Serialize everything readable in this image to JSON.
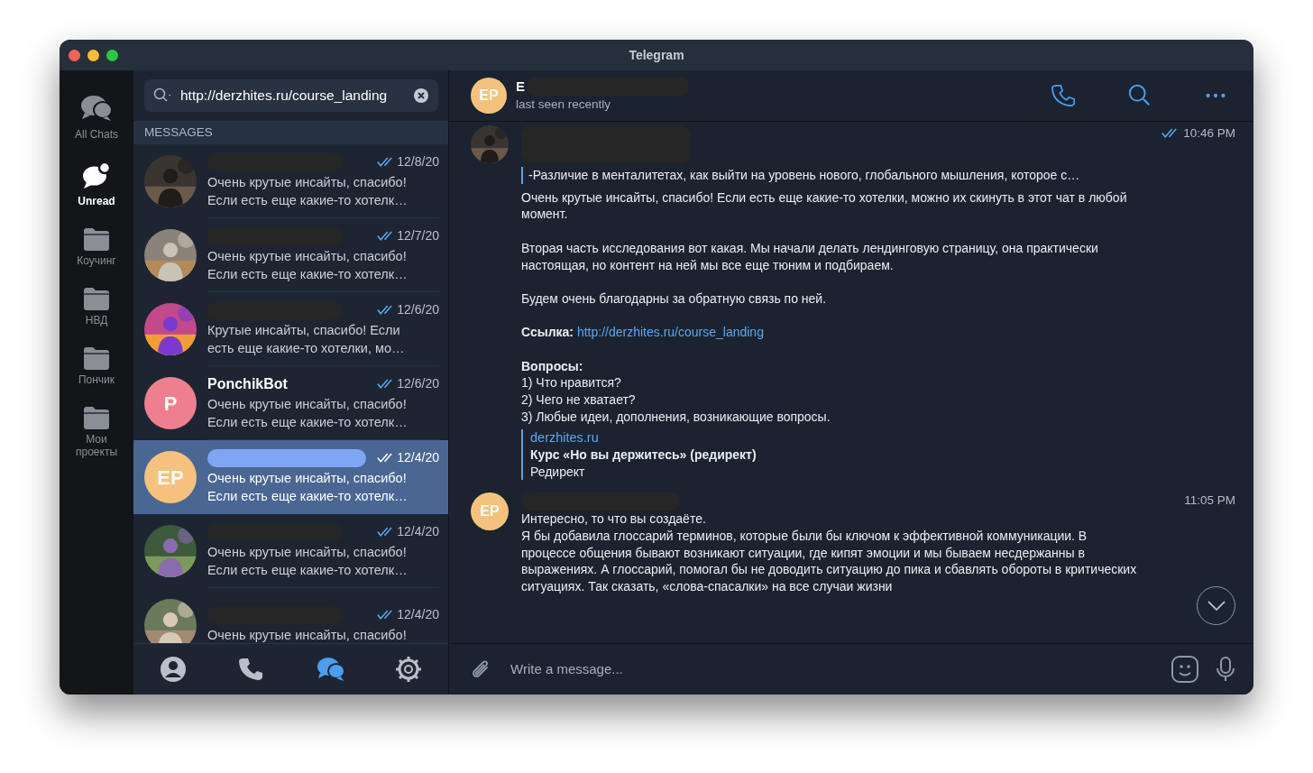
{
  "window": {
    "title": "Telegram"
  },
  "folders": [
    {
      "label": "All Chats",
      "kind": "chats",
      "selected": false
    },
    {
      "label": "Unread",
      "kind": "unread",
      "selected": true
    },
    {
      "label": "Коучинг",
      "kind": "folder",
      "selected": false
    },
    {
      "label": "НВД",
      "kind": "folder",
      "selected": false
    },
    {
      "label": "Пончик",
      "kind": "folder",
      "selected": false
    },
    {
      "label": "Мои проекты",
      "kind": "folder",
      "selected": false
    }
  ],
  "search": {
    "value": "http://derzhites.ru/course_landing"
  },
  "section_header": "MESSAGES",
  "chats": [
    {
      "name_redacted": true,
      "avatar": {
        "kind": "picture"
      },
      "date": "12/8/20",
      "read": true,
      "selected": false,
      "preview": [
        "Очень крутые инсайты, спасибо!",
        "Если есть еще какие-то хотелк…"
      ]
    },
    {
      "name_redacted": true,
      "avatar": {
        "kind": "picture"
      },
      "date": "12/7/20",
      "read": true,
      "selected": false,
      "preview": [
        "Очень крутые инсайты, спасибо!",
        "Если есть еще какие-то хотелк…"
      ]
    },
    {
      "name_redacted": true,
      "avatar": {
        "kind": "picture"
      },
      "date": "12/6/20",
      "read": true,
      "selected": false,
      "preview": [
        "Крутые инсайты, спасибо! Если",
        "есть еще какие-то хотелки, мо…"
      ]
    },
    {
      "name": "PonchikBot",
      "name_redacted": false,
      "avatar": {
        "kind": "initials",
        "initials": "P",
        "color": "#ee7f8f"
      },
      "date": "12/6/20",
      "read": true,
      "selected": false,
      "preview": [
        "Очень крутые инсайты, спасибо!",
        "Если есть еще какие-то хотелк…"
      ]
    },
    {
      "name_redacted": true,
      "avatar": {
        "kind": "initials",
        "initials": "EP",
        "color": "#f5c27e"
      },
      "date": "12/4/20",
      "read": true,
      "selected": true,
      "preview": [
        "Очень крутые инсайты, спасибо!",
        "Если есть еще какие-то хотелк…"
      ]
    },
    {
      "name_redacted": true,
      "avatar": {
        "kind": "picture"
      },
      "date": "12/4/20",
      "read": true,
      "selected": false,
      "preview": [
        "Очень крутые инсайты, спасибо!",
        "Если есть еще какие-то хотелк…"
      ]
    },
    {
      "name_redacted": true,
      "avatar": {
        "kind": "picture"
      },
      "date": "12/4/20",
      "read": true,
      "selected": false,
      "preview": [
        "Очень крутые инсайты, спасибо!"
      ]
    }
  ],
  "bottom_tabs": [
    {
      "kind": "contacts",
      "selected": false
    },
    {
      "kind": "calls",
      "selected": false
    },
    {
      "kind": "chats",
      "selected": true
    },
    {
      "kind": "settings",
      "selected": false
    }
  ],
  "chat_header": {
    "avatar": {
      "initials": "EP",
      "color": "#f5c27e"
    },
    "name": "E",
    "status": "last seen recently"
  },
  "messages": [
    {
      "avatar": {
        "kind": "picture"
      },
      "time": "10:46 PM",
      "read": true,
      "quote": "-Различие в менталитетах, как выйти на уровень нового, глобального мышления, которое с…",
      "blocks": [
        {
          "kind": "text",
          "text": "Очень крутые инсайты, спасибо! Если есть еще какие-то хотелки, можно их скинуть в этот чат в любой момент."
        },
        {
          "kind": "text",
          "text": "Вторая часть исследования вот какая. Мы начали делать лендинговую страницу, она практически настоящая, но контент на ней мы все еще тюним и подбираем."
        },
        {
          "kind": "text",
          "text": "Будем очень благодарны за обратную связь по ней."
        },
        {
          "kind": "link",
          "label": "Ссылка:",
          "url": "http://derzhites.ru/course_landing"
        },
        {
          "kind": "text",
          "text": "**Вопросы:**\n1) Что нравится?\n2) Чего не хватает?\n3) Любые идеи, дополнения, возникающие вопросы."
        },
        {
          "kind": "preview",
          "site": "derzhites.ru",
          "title": "Курс «Но вы держитесь» (редирект)",
          "description": "Редирект"
        }
      ]
    },
    {
      "avatar": {
        "kind": "initials",
        "initials": "EP",
        "color": "#f5c27e"
      },
      "time": "11:05 PM",
      "blocks": [
        {
          "kind": "text",
          "text": "Интересно, то что вы создаёте.\nЯ бы добавила глоссарий терминов, которые были бы ключом к эффективной коммуникации. В процессе общения бывают возникают ситуации, где кипят эмоции и мы бываем несдержанны в выражениях. А глоссарий, помогал бы не доводить ситуацию до пика и сбавлять обороты в критических ситуациях. Так сказать, «слова-спасалки» на все случаи жизни"
        }
      ]
    }
  ],
  "composer": {
    "placeholder": "Write a message..."
  }
}
